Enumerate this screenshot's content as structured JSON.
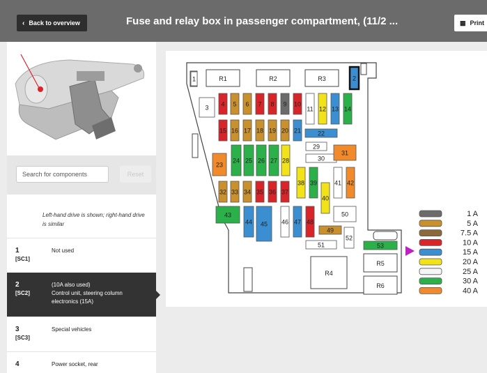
{
  "header": {
    "back_label": "Back to overview",
    "title": "Fuse and relay box in passenger compartment, (11/2 ...",
    "print_label": "Print"
  },
  "search": {
    "placeholder": "Search for components",
    "reset_label": "Reset"
  },
  "note": "Left-hand drive is shown; right-hand drive is similar",
  "list_items": [
    {
      "number": "1",
      "code": "[SC1]",
      "description": "Not used"
    },
    {
      "number": "2",
      "code": "[SC2]",
      "description": "(10A also used)\nControl unit, steering column electronics (15A)"
    },
    {
      "number": "3",
      "code": "[SC3]",
      "description": "Special vehicles"
    },
    {
      "number": "4",
      "code": "",
      "description": "Power socket, rear"
    }
  ],
  "diagram": {
    "relays": [
      "R1",
      "R2",
      "R3",
      "R4",
      "R5",
      "R6"
    ],
    "fuses": [
      {
        "n": "1",
        "color": "white"
      },
      {
        "n": "2",
        "color": "blue"
      },
      {
        "n": "3",
        "color": "white"
      },
      {
        "n": "4",
        "color": "red"
      },
      {
        "n": "5",
        "color": "brown"
      },
      {
        "n": "6",
        "color": "brown"
      },
      {
        "n": "7",
        "color": "red"
      },
      {
        "n": "8",
        "color": "red"
      },
      {
        "n": "9",
        "color": "gray"
      },
      {
        "n": "10",
        "color": "red"
      },
      {
        "n": "11",
        "color": "white"
      },
      {
        "n": "12",
        "color": "yellow"
      },
      {
        "n": "13",
        "color": "blue"
      },
      {
        "n": "14",
        "color": "green"
      },
      {
        "n": "15",
        "color": "red"
      },
      {
        "n": "16",
        "color": "brown"
      },
      {
        "n": "17",
        "color": "brown"
      },
      {
        "n": "18",
        "color": "brown"
      },
      {
        "n": "19",
        "color": "brown"
      },
      {
        "n": "20",
        "color": "brown"
      },
      {
        "n": "21",
        "color": "blue"
      },
      {
        "n": "22",
        "color": "blue"
      },
      {
        "n": "23",
        "color": "orange"
      },
      {
        "n": "24",
        "color": "green"
      },
      {
        "n": "25",
        "color": "green"
      },
      {
        "n": "26",
        "color": "green"
      },
      {
        "n": "27",
        "color": "green"
      },
      {
        "n": "28",
        "color": "yellow"
      },
      {
        "n": "29",
        "color": "white"
      },
      {
        "n": "30",
        "color": "white"
      },
      {
        "n": "31",
        "color": "orange"
      },
      {
        "n": "32",
        "color": "brown"
      },
      {
        "n": "33",
        "color": "brown"
      },
      {
        "n": "34",
        "color": "brown"
      },
      {
        "n": "35",
        "color": "red"
      },
      {
        "n": "36",
        "color": "red"
      },
      {
        "n": "37",
        "color": "red"
      },
      {
        "n": "38",
        "color": "yellow"
      },
      {
        "n": "39",
        "color": "green"
      },
      {
        "n": "40",
        "color": "yellow"
      },
      {
        "n": "41",
        "color": "white"
      },
      {
        "n": "42",
        "color": "orange"
      },
      {
        "n": "43",
        "color": "green"
      },
      {
        "n": "44",
        "color": "blue"
      },
      {
        "n": "45",
        "color": "blue"
      },
      {
        "n": "46",
        "color": "white"
      },
      {
        "n": "47",
        "color": "blue"
      },
      {
        "n": "48",
        "color": "red"
      },
      {
        "n": "49",
        "color": "brown"
      },
      {
        "n": "50",
        "color": "white"
      },
      {
        "n": "51",
        "color": "white"
      },
      {
        "n": "52",
        "color": "white"
      },
      {
        "n": "53",
        "color": "green"
      }
    ],
    "legend": [
      {
        "label": "1 A",
        "color": "#6b6b6b"
      },
      {
        "label": "5 A",
        "color": "#c9902e"
      },
      {
        "label": "7.5 A",
        "color": "#8a6a3a"
      },
      {
        "label": "10 A",
        "color": "#d8252a"
      },
      {
        "label": "15 A",
        "color": "#3b8fd0"
      },
      {
        "label": "20 A",
        "color": "#f2e21a"
      },
      {
        "label": "25 A",
        "color": "#f6f6f6"
      },
      {
        "label": "30 A",
        "color": "#2bb04a"
      },
      {
        "label": "40 A",
        "color": "#f08a2a"
      }
    ],
    "palette": {
      "white": "#ffffff",
      "blue": "#3b8fd0",
      "red": "#d8252a",
      "brown": "#c9902e",
      "gray": "#6b6b6b",
      "yellow": "#f2e21a",
      "green": "#2bb04a",
      "orange": "#f08a2a"
    },
    "marker_color": "#c020c0"
  }
}
